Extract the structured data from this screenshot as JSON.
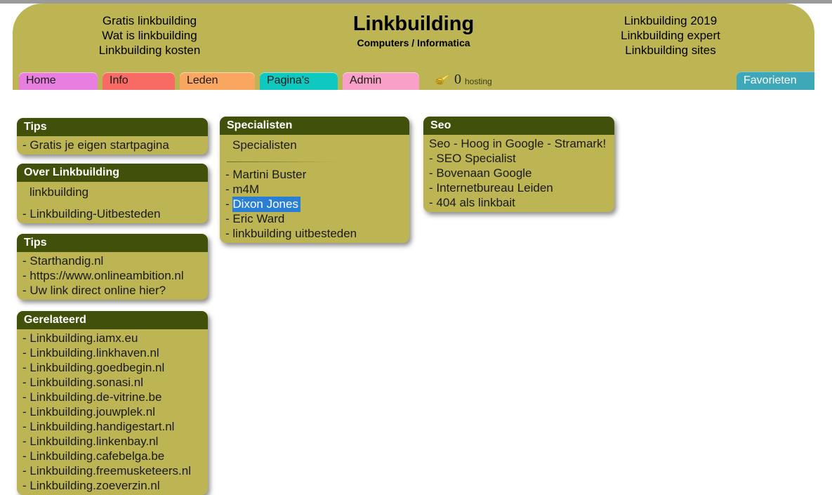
{
  "header": {
    "title": "Linkbuilding",
    "subtitle": "Computers / Informatica",
    "left_links": [
      "Gratis linkbuilding",
      "Wat is linkbuilding",
      "Linkbuilding kosten"
    ],
    "right_links": [
      "Linkbuilding 2019",
      "Linkbuilding expert",
      "Linkbuilding sites"
    ],
    "colors": {
      "banner_bg": "#bdb554",
      "box_header_bg": "#41500a",
      "selection_blue": "#2a7fd4",
      "favorites_teal": "#3ea7b8"
    }
  },
  "nav": {
    "tabs": [
      {
        "label": "Home",
        "color": "#e87fe0"
      },
      {
        "label": "Info",
        "color": "#f86a64"
      },
      {
        "label": "Leden",
        "color": "#f9a661"
      },
      {
        "label": "Pagina's",
        "color": "#0fc8c0"
      },
      {
        "label": "Admin",
        "color": "#f9a0c8"
      }
    ],
    "favorites_label": "Favorieten",
    "hosting": {
      "icon": "comet-icon",
      "count": "0",
      "label": "hosting"
    }
  },
  "boxes": {
    "tips1": {
      "title": "Tips",
      "items": [
        {
          "text": "Gratis je eigen startpagina",
          "bullet": true,
          "selected": false
        }
      ]
    },
    "over": {
      "title": "Over Linkbuilding",
      "items": [
        {
          "text": "linkbuilding",
          "bullet": false,
          "selected": false
        },
        {
          "text": "Linkbuilding-Uitbesteden",
          "bullet": true,
          "selected": false
        }
      ]
    },
    "tips2": {
      "title": "Tips",
      "items": [
        {
          "text": "Starthandig.nl",
          "bullet": true,
          "selected": false
        },
        {
          "text": "https://www.onlineambition.nl",
          "bullet": true,
          "selected": false
        },
        {
          "text": "Uw link direct online hier?",
          "bullet": true,
          "selected": false
        }
      ]
    },
    "gerelateerd": {
      "title": "Gerelateerd",
      "items": [
        {
          "text": "Linkbuilding.iamx.eu",
          "bullet": true,
          "selected": false
        },
        {
          "text": "Linkbuilding.linkhaven.nl",
          "bullet": true,
          "selected": false
        },
        {
          "text": "Linkbuilding.goedbegin.nl",
          "bullet": true,
          "selected": false
        },
        {
          "text": "Linkbuilding.sonasi.nl",
          "bullet": true,
          "selected": false
        },
        {
          "text": "Linkbuilding.de-vitrine.be",
          "bullet": true,
          "selected": false
        },
        {
          "text": "Linkbuilding.jouwplek.nl",
          "bullet": true,
          "selected": false
        },
        {
          "text": "Linkbuilding.handigestart.nl",
          "bullet": true,
          "selected": false
        },
        {
          "text": "Linkbuilding.linkenbay.nl",
          "bullet": true,
          "selected": false
        },
        {
          "text": "Linkbuilding.cafebelga.be",
          "bullet": true,
          "selected": false
        },
        {
          "text": "Linkbuilding.freemusketeers.nl",
          "bullet": true,
          "selected": false
        },
        {
          "text": "Linkbuilding.zoeverzin.nl",
          "bullet": true,
          "selected": false
        }
      ]
    },
    "specialisten": {
      "title": "Specialisten",
      "lead": "Specialisten",
      "items": [
        {
          "text": "Martini Buster",
          "bullet": true,
          "selected": false
        },
        {
          "text": "m4M",
          "bullet": true,
          "selected": false
        },
        {
          "text": "Dixon Jones",
          "bullet": true,
          "selected": true
        },
        {
          "text": "Eric Ward",
          "bullet": true,
          "selected": false
        },
        {
          "text": "linkbuilding uitbesteden",
          "bullet": true,
          "selected": false
        }
      ]
    },
    "seo": {
      "title": "Seo",
      "items": [
        {
          "text": "Seo - Hoog in Google - Stramark!",
          "bullet": false,
          "selected": false
        },
        {
          "text": "SEO Specialist",
          "bullet": true,
          "selected": false
        },
        {
          "text": "Bovenaan Google",
          "bullet": true,
          "selected": false
        },
        {
          "text": "Internetbureau Leiden",
          "bullet": true,
          "selected": false
        },
        {
          "text": "404 als linkbait",
          "bullet": true,
          "selected": false
        }
      ]
    }
  }
}
